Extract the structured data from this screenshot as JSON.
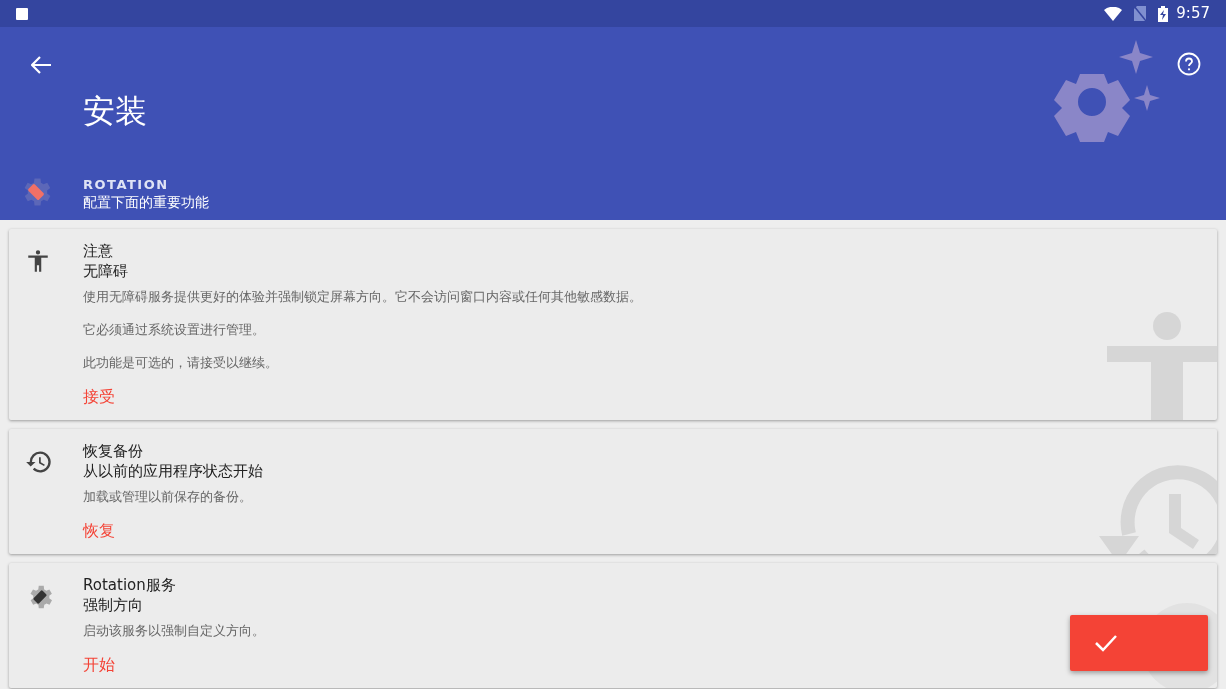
{
  "status_bar": {
    "time": "9:57"
  },
  "header": {
    "title": "安装",
    "app_name": "ROTATION",
    "subtitle": "配置下面的重要功能"
  },
  "cards": [
    {
      "kind": "accessibility",
      "title": "注意",
      "subtitle": "无障碍",
      "paragraphs": [
        "使用无障碍服务提供更好的体验并强制锁定屏幕方向。它不会访问窗口内容或任何其他敏感数据。",
        "它必须通过系统设置进行管理。",
        "此功能是可选的，请接受以继续。"
      ],
      "action": "接受"
    },
    {
      "kind": "restore",
      "title": "恢复备份",
      "subtitle": "从以前的应用程序状态开始",
      "paragraphs": [
        "加载或管理以前保存的备份。"
      ],
      "action": "恢复"
    },
    {
      "kind": "service",
      "title": "Rotation服务",
      "subtitle": "强制方向",
      "paragraphs": [
        "启动该服务以强制自定义方向。"
      ],
      "action": "开始"
    }
  ]
}
